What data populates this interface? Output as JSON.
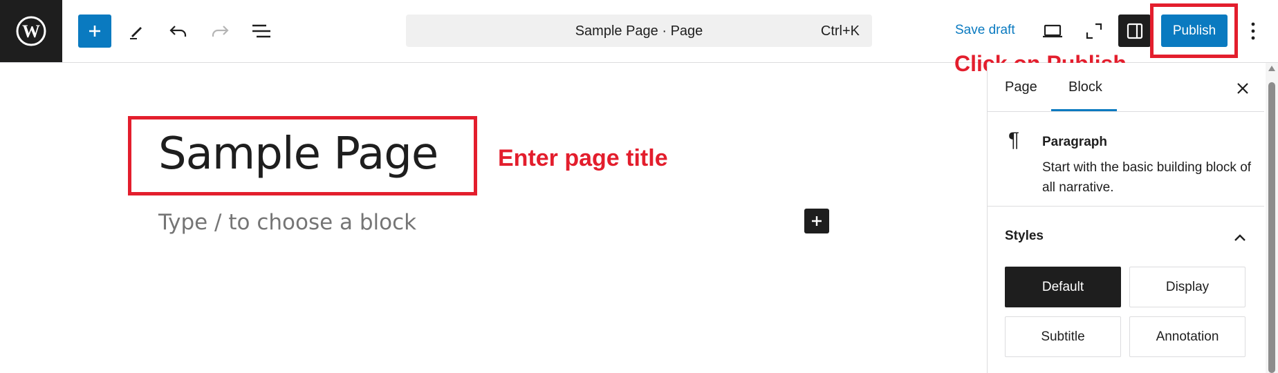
{
  "toolbar": {
    "command_title": "Sample Page · Page",
    "command_shortcut": "Ctrl+K",
    "save_draft_label": "Save draft",
    "publish_label": "Publish"
  },
  "annotations": {
    "publish_note": "Click on Publish",
    "title_note": "Enter page title"
  },
  "editor": {
    "title": "Sample Page",
    "placeholder": "Type / to choose a block"
  },
  "sidebar": {
    "tabs": [
      {
        "label": "Page",
        "active": false
      },
      {
        "label": "Block",
        "active": true
      }
    ],
    "block": {
      "icon": "paragraph-icon",
      "name": "Paragraph",
      "description": "Start with the basic building block of all narrative."
    },
    "styles_heading": "Styles",
    "styles": [
      {
        "label": "Default",
        "selected": true
      },
      {
        "label": "Display",
        "selected": false
      },
      {
        "label": "Subtitle",
        "selected": false
      },
      {
        "label": "Annotation",
        "selected": false
      }
    ]
  },
  "colors": {
    "accent": "#0a7ac0",
    "annotation_red": "#e31e2d",
    "dark": "#1e1e1e"
  }
}
